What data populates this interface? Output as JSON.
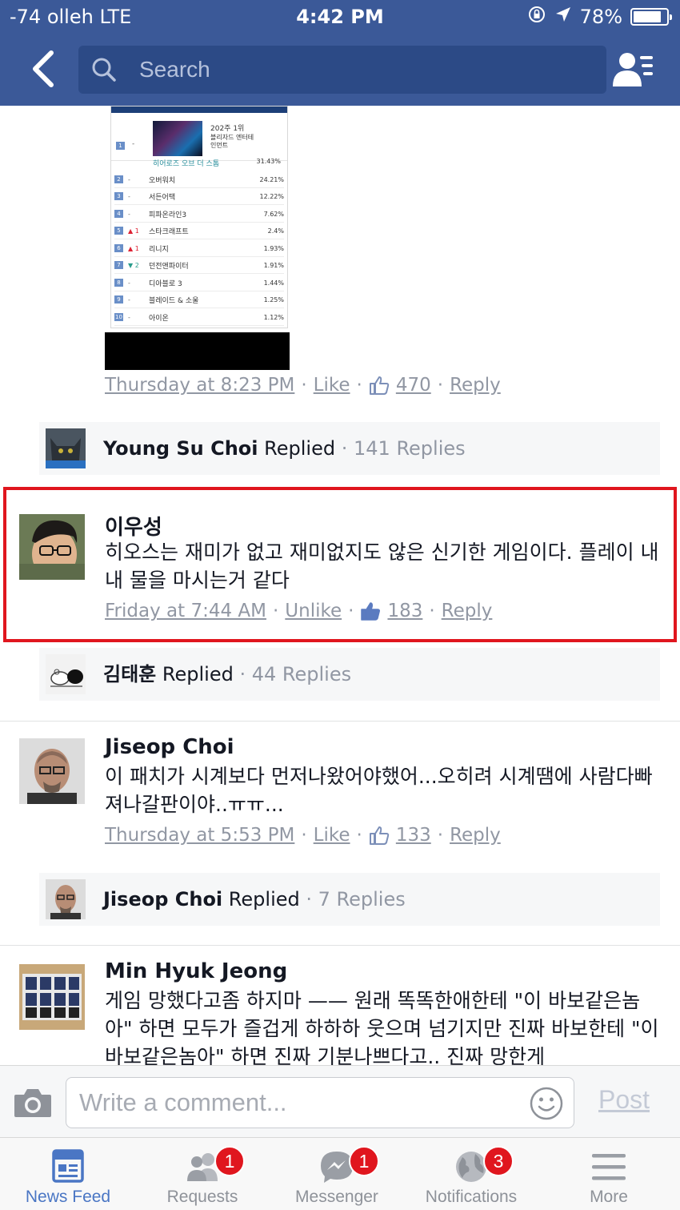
{
  "status_bar": {
    "carrier": "-74 olleh   LTE",
    "time": "4:42 PM",
    "battery": "78%"
  },
  "header": {
    "search_placeholder": "Search"
  },
  "ranking_image": {
    "first": {
      "rank": "1",
      "week_label": "202주 1위",
      "publisher": "블리자드 엔터테인먼트",
      "name": "히어로즈 오브 더 스톰",
      "percent": "31.43%"
    },
    "rows": [
      {
        "rank": "2",
        "change": "-",
        "name": "오버워치",
        "percent": "24.21%"
      },
      {
        "rank": "3",
        "change": "-",
        "name": "서든어택",
        "percent": "12.22%"
      },
      {
        "rank": "4",
        "change": "-",
        "name": "피파온라인3",
        "percent": "7.62%"
      },
      {
        "rank": "5",
        "change": "▲ 1",
        "name": "스타크래프트",
        "percent": "2.4%"
      },
      {
        "rank": "6",
        "change": "▲ 1",
        "name": "리니지",
        "percent": "1.93%"
      },
      {
        "rank": "7",
        "change": "▼ 2",
        "name": "던전앤파이터",
        "percent": "1.91%"
      },
      {
        "rank": "8",
        "change": "-",
        "name": "디아블로 3",
        "percent": "1.44%"
      },
      {
        "rank": "9",
        "change": "-",
        "name": "블레이드 & 소울",
        "percent": "1.25%"
      },
      {
        "rank": "10",
        "change": "-",
        "name": "아이온",
        "percent": "1.12%"
      }
    ]
  },
  "comment0": {
    "time": "Thursday at 8:23 PM",
    "action": "Like",
    "likes": "470",
    "reply": "Reply",
    "replied_name": "Young Su Choi",
    "replied_word": "Replied",
    "replies": "141 Replies"
  },
  "comment1": {
    "name": "이우성",
    "body": "히오스는 재미가 없고 재미없지도 않은 신기한 게임이다. 플레이 내내 물을 마시는거 같다",
    "time": "Friday at 7:44 AM",
    "action": "Unlike",
    "likes": "183",
    "reply": "Reply",
    "replied_name": "김태훈",
    "replied_word": "Replied",
    "replies": "44 Replies"
  },
  "comment2": {
    "name": "Jiseop Choi",
    "body": "이 패치가 시계보다 먼저나왔어야했어...오히려 시계땜에 사람다빠져나갈판이야..ㅠㅠ...",
    "time": "Thursday at 5:53 PM",
    "action": "Like",
    "likes": "133",
    "reply": "Reply",
    "replied_name": "Jiseop Choi",
    "replied_word": "Replied",
    "replies": "7 Replies"
  },
  "comment3": {
    "name": "Min Hyuk Jeong",
    "body": "게임 망했다고좀 하지마 —— 원래 똑똑한애한테 \"이 바보같은놈아\" 하면 모두가 즐겁게 하하하 웃으며 넘기지만 진짜 바보한테 \"이 바보같은놈아\" 하면 진짜 기분나쁘다고.. 진짜 망한게"
  },
  "composer": {
    "placeholder": "Write a comment...",
    "post": "Post"
  },
  "tabs": [
    {
      "label": "News Feed",
      "badge": ""
    },
    {
      "label": "Requests",
      "badge": "1"
    },
    {
      "label": "Messenger",
      "badge": "1"
    },
    {
      "label": "Notifications",
      "badge": "3"
    },
    {
      "label": "More",
      "badge": ""
    }
  ],
  "colors": {
    "brand": "#3b5998",
    "highlight": "#e0161e",
    "badge": "#e0161e",
    "active_tab": "#4a76c4"
  }
}
